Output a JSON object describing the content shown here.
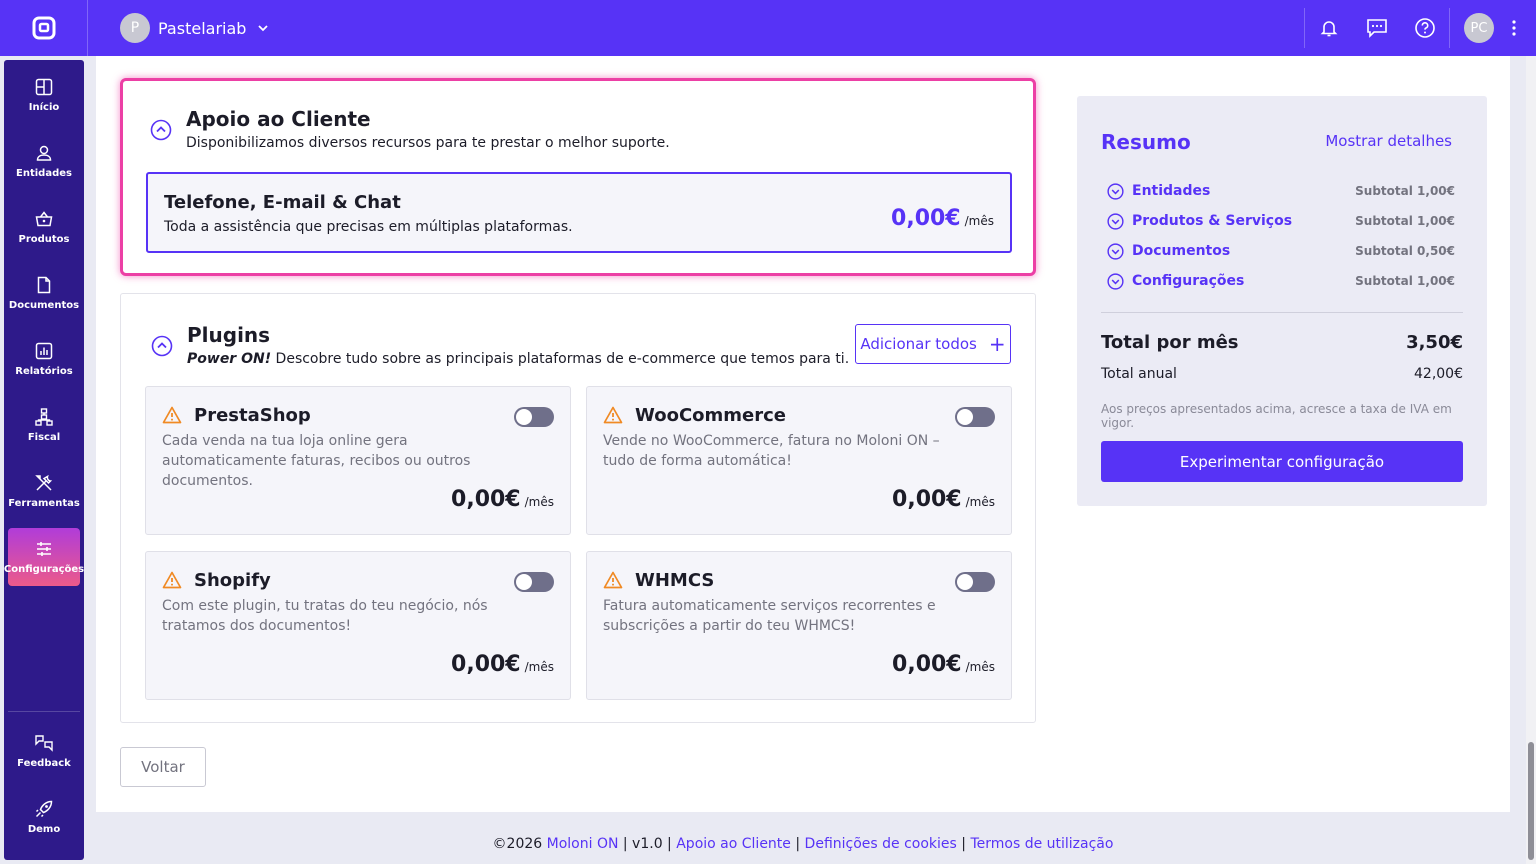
{
  "topbar": {
    "company_initial": "P",
    "company_name": "Pastelariab",
    "user_initials": "PC"
  },
  "sidebar": {
    "items": [
      {
        "label": "Início",
        "icon": "dashboard-icon"
      },
      {
        "label": "Entidades",
        "icon": "user-icon"
      },
      {
        "label": "Produtos",
        "icon": "basket-icon"
      },
      {
        "label": "Documentos",
        "icon": "document-icon"
      },
      {
        "label": "Relatórios",
        "icon": "chart-icon"
      },
      {
        "label": "Fiscal",
        "icon": "network-icon"
      },
      {
        "label": "Ferramentas",
        "icon": "tools-icon"
      },
      {
        "label": "Configurações",
        "icon": "sliders-icon"
      }
    ],
    "bottom": [
      {
        "label": "Feedback",
        "icon": "feedback-icon"
      },
      {
        "label": "Demo",
        "icon": "rocket-icon"
      }
    ],
    "active_index": 7
  },
  "apoio": {
    "title": "Apoio ao Cliente",
    "subtitle": "Disponibilizamos diversos recursos para te prestar o melhor suporte.",
    "option": {
      "title": "Telefone, E-mail & Chat",
      "description": "Toda a assistência que precisas em múltiplas plataformas.",
      "price": "0,00€",
      "unit": "/mês"
    }
  },
  "plugins": {
    "title": "Plugins",
    "subtitle_bold": "Power ON!",
    "subtitle_rest": " Descobre tudo sobre as principais plataformas de e-commerce que temos para ti.",
    "add_all_label": "Adicionar todos",
    "items": [
      {
        "name": "PrestaShop",
        "description": "Cada venda na tua loja online gera automaticamente faturas, recibos ou outros documentos.",
        "price": "0,00€",
        "unit": "/mês",
        "enabled": false
      },
      {
        "name": "WooCommerce",
        "description": "Vende no WooCommerce, fatura no Moloni ON – tudo de forma automática!",
        "price": "0,00€",
        "unit": "/mês",
        "enabled": false
      },
      {
        "name": "Shopify",
        "description": "Com este plugin, tu tratas do teu negócio, nós tratamos dos documentos!",
        "price": "0,00€",
        "unit": "/mês",
        "enabled": false
      },
      {
        "name": "WHMCS",
        "description": "Fatura automaticamente serviços recorrentes e subscrições a partir do teu WHMCS!",
        "price": "0,00€",
        "unit": "/mês",
        "enabled": false
      }
    ]
  },
  "back_label": "Voltar",
  "resumo": {
    "title": "Resumo",
    "details_link": "Mostrar detalhes",
    "rows": [
      {
        "name": "Entidades",
        "subtotal": "Subtotal 1,00€"
      },
      {
        "name": "Produtos & Serviços",
        "subtotal": "Subtotal 1,00€"
      },
      {
        "name": "Documentos",
        "subtotal": "Subtotal 0,50€"
      },
      {
        "name": "Configurações",
        "subtotal": "Subtotal 1,00€"
      }
    ],
    "total_label": "Total por mês",
    "total_value": "3,50€",
    "annual_label": "Total anual",
    "annual_value": "42,00€",
    "vat_note": "Aos preços apresentados acima, acresce a taxa de IVA em vigor.",
    "cta_label": "Experimentar configuração"
  },
  "footer": {
    "copyright": "©2026 ",
    "brand": "Moloni ON",
    "version": " | v1.0 | ",
    "link1": "Apoio ao Cliente",
    "sep1": " | ",
    "link2": "Definições de cookies",
    "sep2": " | ",
    "link3": "Termos de utilização"
  },
  "colors": {
    "brand": "#5733f6",
    "sidebar": "#2e1a8a",
    "highlight": "#ec3fa5",
    "warning": "#f08a24"
  }
}
